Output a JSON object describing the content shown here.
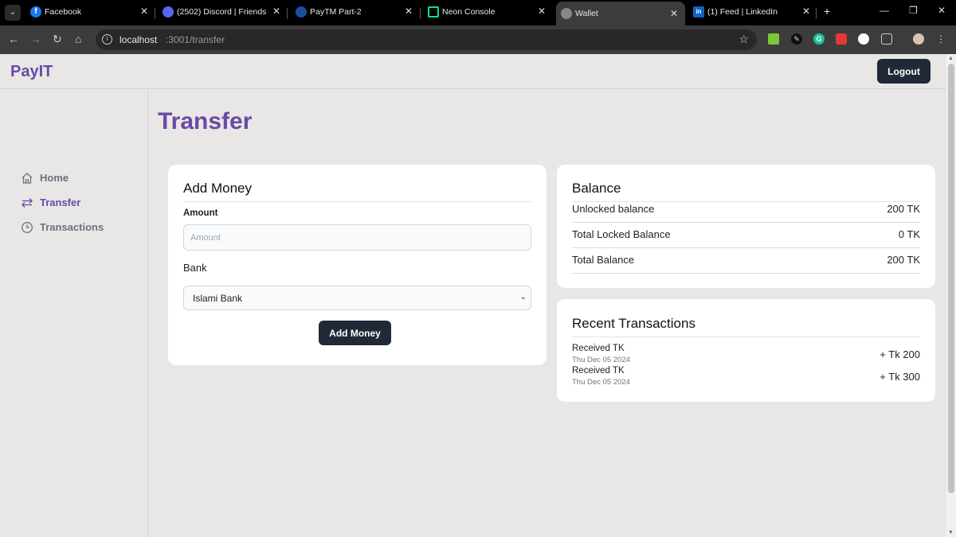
{
  "browser": {
    "tabs": [
      {
        "title": "Facebook"
      },
      {
        "title": "(2502) Discord | Friends"
      },
      {
        "title": "PayTM Part-2"
      },
      {
        "title": "Neon Console"
      },
      {
        "title": "Wallet"
      },
      {
        "title": "(1) Feed | LinkedIn"
      }
    ],
    "url_host": "localhost",
    "url_path": ":3001/transfer",
    "colors": {
      "tab_bar": "#000000",
      "toolbar": "#3c3c3c",
      "active_tab": "#3c3c3c"
    }
  },
  "app": {
    "brand": "PayIT",
    "logout_label": "Logout",
    "page_title": "Transfer",
    "nav": [
      {
        "label": "Home",
        "icon": "home-icon"
      },
      {
        "label": "Transfer",
        "icon": "arrows-transfer-icon"
      },
      {
        "label": "Transactions",
        "icon": "clock-icon"
      }
    ],
    "add_money": {
      "title": "Add Money",
      "amount_label": "Amount",
      "amount_placeholder": "Amount",
      "bank_label": "Bank",
      "bank_selected": "Islami Bank",
      "button_label": "Add Money"
    },
    "balance": {
      "title": "Balance",
      "rows": [
        {
          "label": "Unlocked balance",
          "value": "200 TK"
        },
        {
          "label": "Total Locked Balance",
          "value": "0 TK"
        },
        {
          "label": "Total Balance",
          "value": "200 TK"
        }
      ]
    },
    "recent": {
      "title": "Recent Transactions",
      "items": [
        {
          "title": "Received TK",
          "date": "Thu Dec 05 2024",
          "amount": "+ Tk 200"
        },
        {
          "title": "Received TK",
          "date": "Thu Dec 05 2024",
          "amount": "+ Tk 300"
        }
      ]
    },
    "colors": {
      "brand": "#6a4aa5",
      "button": "#1f2937",
      "background": "#e9e6e6"
    }
  }
}
